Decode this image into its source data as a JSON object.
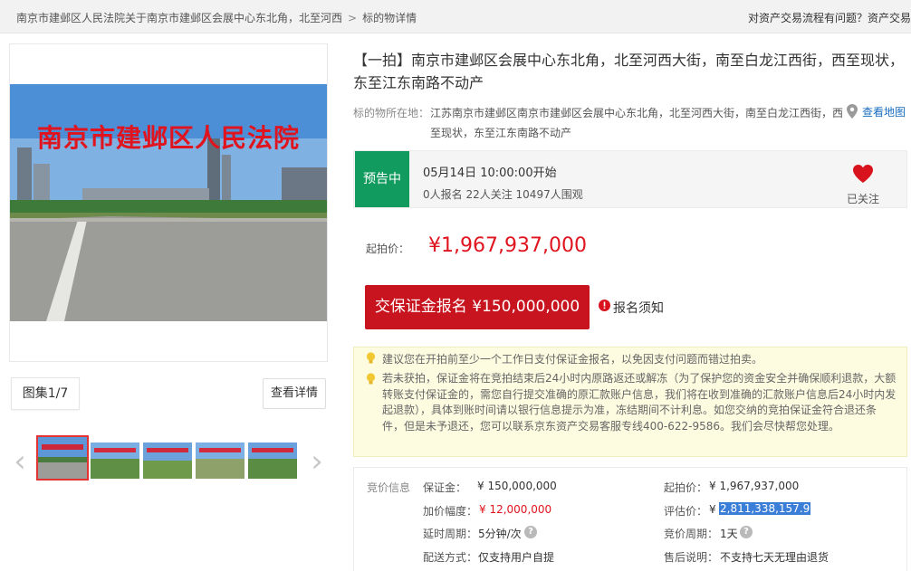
{
  "breadcrumb": {
    "court": "南京市建邺区人民法院",
    "item": "关于南京市建邺区会展中心东北角，北至河西",
    "current": "标的物详情",
    "separator": ">"
  },
  "help_link": "对资产交易流程有问题？资产交易",
  "photo": {
    "caption": "南京市建邺区人民法院"
  },
  "gallery": {
    "count_label": "图集1/7",
    "detail_button": "查看详情",
    "prev_arrow": "‹",
    "next_arrow": "›"
  },
  "listing": {
    "title": "【一拍】南京市建邺区会展中心东北角，北至河西大街，南至白龙江西街，西至现状，东至江东南路不动产",
    "location_label": "标的物所在地：",
    "location_text": "江苏南京市建邺区南京市建邺区会展中心东北角，北至河西大街，南至白龙江西街，西至现状，东至江东南路不动产",
    "map_link": "查看地图"
  },
  "status": {
    "badge": "预告中",
    "start_time": "05月14日 10:00:00开始",
    "stats": "0人报名  22人关注  10497人围观",
    "follow_label": "已关注"
  },
  "price": {
    "label": "起拍价：",
    "value": "¥1,967,937,000"
  },
  "actions": {
    "deposit_button": "交保证金报名 ¥150,000,000",
    "notice_link": "报名须知"
  },
  "tips": {
    "tip1": "建议您在开拍前至少一个工作日支付保证金报名，以免因支付问题而错过拍卖。",
    "tip2": "若未获拍，保证金将在竞拍结束后24小时内原路返还或解冻（为了保护您的资金安全并确保顺利退款，大额转账支付保证金的，需您自行提交准确的原汇款账户信息，我们将在收到准确的汇款账户信息后24小时内发起退款），具体到账时间请以银行信息提示为准，冻结期间不计利息。如您交纳的竞拍保证金符合退还条件，但是未予退还，您可以联系京东资产交易客服专线400-622-9586。我们会尽快帮您处理。"
  },
  "auction_info": {
    "section_label": "竞价信息",
    "deposit_label": "保证金：",
    "deposit_value": "¥ 150,000,000",
    "increment_label": "加价幅度：",
    "increment_value": "¥ 12,000,000",
    "extension_label": "延时周期：",
    "extension_value": "5分钟/次",
    "delivery_label": "配送方式：",
    "delivery_value": "仅支持用户自提",
    "start_price_label": "起拍价：",
    "start_price_value": "¥ 1,967,937,000",
    "appraisal_label": "评估价：",
    "appraisal_currency": "¥",
    "appraisal_value": "2,811,338,157.9",
    "cycle_label": "竞价周期：",
    "cycle_value": "1天",
    "after_sale_label": "售后说明：",
    "after_sale_value": "不支持七天无理由退货"
  },
  "colors": {
    "accent_red": "#c8141e",
    "price_red": "#e0141e",
    "badge_green": "#129b5f",
    "link_blue": "#1a6ec0"
  }
}
